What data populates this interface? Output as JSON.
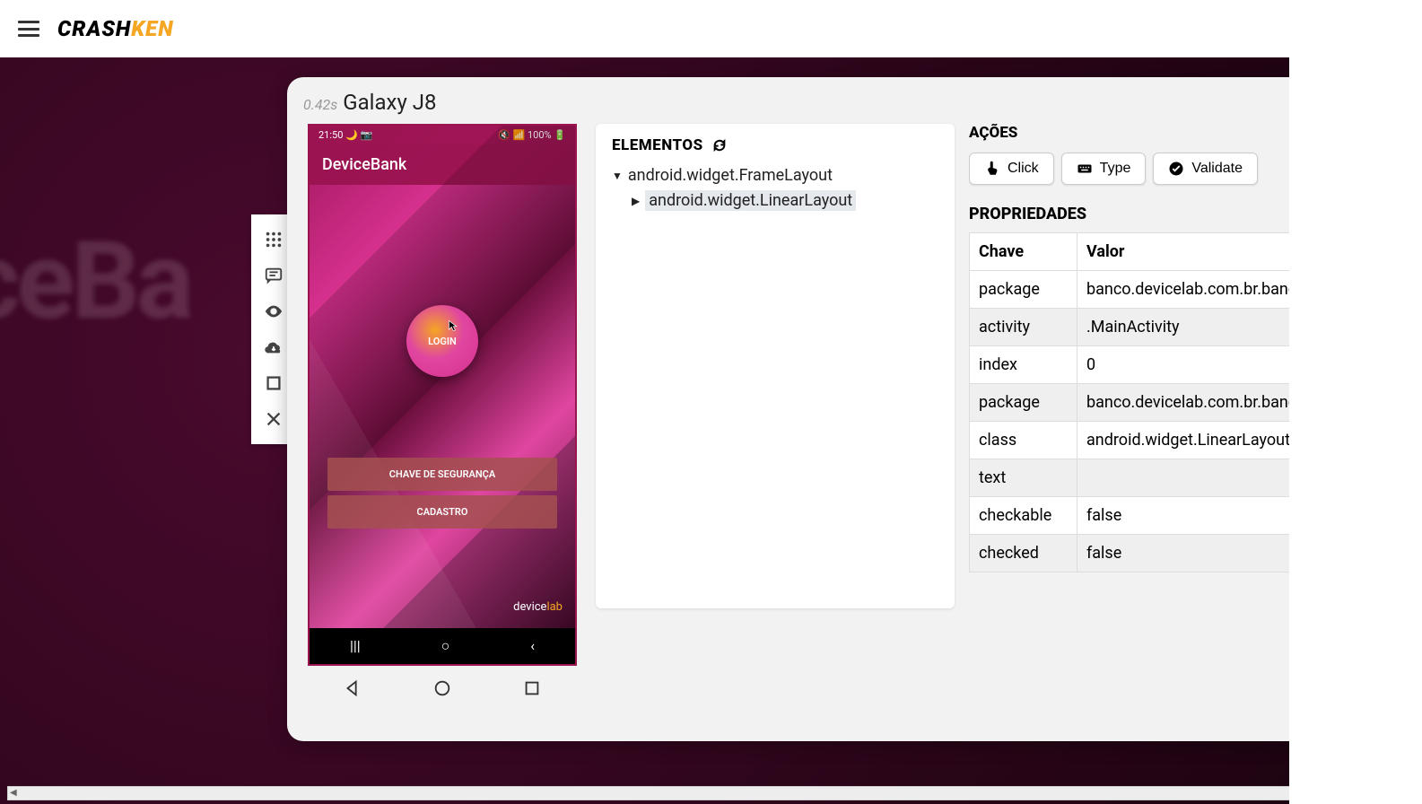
{
  "brand": {
    "crash": "CRASH",
    "ken": "KEN"
  },
  "bg_text": "ceBa",
  "title": {
    "latency": "0.42s",
    "device": "Galaxy J8"
  },
  "device": {
    "status_left": "21:50 🌙 📷",
    "status_right": "🔇 📶 100% 🔋",
    "app_title": "DeviceBank",
    "login_label": "LOGIN",
    "security_btn": "CHAVE DE SEGURANÇA",
    "register_btn": "CADASTRO",
    "brand_device": "device",
    "brand_lab": "lab",
    "nav1": "|||",
    "nav2": "○",
    "nav3": "‹"
  },
  "elements": {
    "title": "ELEMENTOS",
    "root_node": "android.widget.FrameLayout",
    "child_node": "android.widget.LinearLayout"
  },
  "actions": {
    "title": "AÇÕES",
    "click": "Click",
    "type": "Type",
    "validate": "Validate"
  },
  "properties": {
    "title": "PROPRIEDADES",
    "headers": {
      "key": "Chave",
      "value": "Valor"
    },
    "rows": [
      {
        "k": "package",
        "v": "banco.devicelab.com.br.banco"
      },
      {
        "k": "activity",
        "v": ".MainActivity"
      },
      {
        "k": "index",
        "v": "0"
      },
      {
        "k": "package",
        "v": "banco.devicelab.com.br.banco"
      },
      {
        "k": "class",
        "v": "android.widget.LinearLayout"
      },
      {
        "k": "text",
        "v": ""
      },
      {
        "k": "checkable",
        "v": "false"
      },
      {
        "k": "checked",
        "v": "false"
      }
    ]
  }
}
